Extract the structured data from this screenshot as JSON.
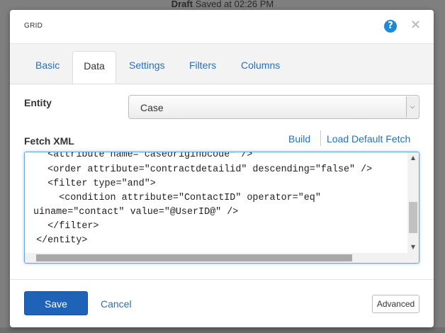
{
  "status": {
    "draft": "Draft",
    "saved": "Saved at 02:26 PM"
  },
  "dialog": {
    "title": "GRID",
    "help_icon": "question-icon",
    "close_icon": "close-icon",
    "help_glyph": "?",
    "close_glyph": "×"
  },
  "tabs": [
    "Basic",
    "Data",
    "Settings",
    "Filters",
    "Columns"
  ],
  "active_tab": "Data",
  "entity": {
    "label": "Entity",
    "selected": "Case",
    "arrow": "⌵"
  },
  "fetch": {
    "label": "Fetch XML",
    "build": "Build",
    "load_default": "Load Default Fetch",
    "lines": [
      "    <attribute name=\"caseoriginbcode\" />",
      "    <order attribute=\"contractdetailid\" descending=\"false\" />",
      "    <filter type=\"and\">",
      "      <condition attribute=\"ContactID\" operator=\"eq\"",
      "uiname=\"contact\" value=\"@UserID@\" />",
      "    </filter>",
      "  </entity>"
    ]
  },
  "scroll": {
    "up": "▲",
    "down": "▼"
  },
  "footer": {
    "save": "Save",
    "cancel": "Cancel",
    "advanced": "Advanced"
  },
  "colors": {
    "primary": "#1f63b8",
    "link": "#2a6fb6",
    "help": "#1e8ad6"
  }
}
